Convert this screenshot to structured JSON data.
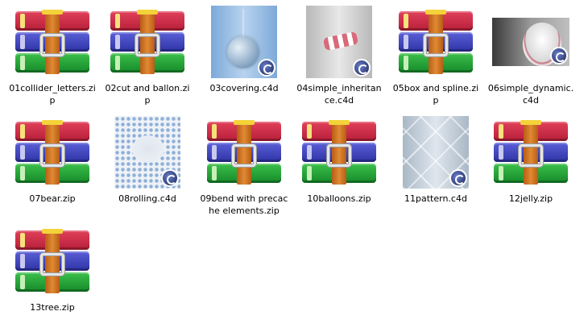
{
  "files": [
    {
      "name": "01collider_letters.zip",
      "type": "archive",
      "icon": "archive-icon"
    },
    {
      "name": "02cut and ballon.zip",
      "type": "archive",
      "icon": "archive-icon"
    },
    {
      "name": "03covering.c4d",
      "type": "c4d",
      "icon": "cinema4d-thumbnail"
    },
    {
      "name": "04simple_inheritance.c4d",
      "type": "c4d",
      "icon": "cinema4d-thumbnail"
    },
    {
      "name": "05box and spline.zip",
      "type": "archive",
      "icon": "archive-icon"
    },
    {
      "name": "06simple_dynamic.c4d",
      "type": "c4d",
      "icon": "cinema4d-thumbnail"
    },
    {
      "name": "07bear.zip",
      "type": "archive",
      "icon": "archive-icon"
    },
    {
      "name": "08rolling.c4d",
      "type": "c4d",
      "icon": "cinema4d-thumbnail"
    },
    {
      "name": "09bend with precache elements.zip",
      "type": "archive",
      "icon": "archive-icon"
    },
    {
      "name": "10balloons.zip",
      "type": "archive",
      "icon": "archive-icon"
    },
    {
      "name": "11pattern.c4d",
      "type": "c4d",
      "icon": "cinema4d-thumbnail"
    },
    {
      "name": "12jelly.zip",
      "type": "archive",
      "icon": "archive-icon"
    },
    {
      "name": "13tree.zip",
      "type": "archive",
      "icon": "archive-icon"
    }
  ]
}
